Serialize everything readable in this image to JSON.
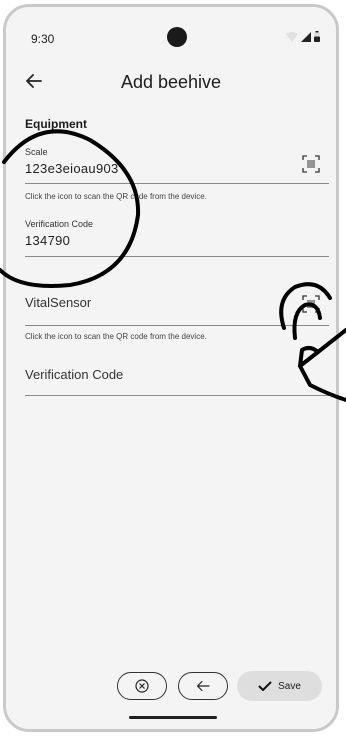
{
  "status": {
    "time": "9:30"
  },
  "appbar": {
    "title": "Add beehive"
  },
  "section": {
    "title": "Equipment"
  },
  "scale": {
    "label": "Scale",
    "value": "123e3eioau903",
    "hint": "Click the icon to scan the QR code from the device."
  },
  "scale_verification": {
    "label": "Verification Code",
    "value": "134790"
  },
  "vital": {
    "label": "VitalSensor",
    "hint": "Click the icon to scan the QR code from the device."
  },
  "vital_verification": {
    "label": "Verification Code"
  },
  "actions": {
    "save_label": "Save"
  },
  "colors": {
    "background": "#f4f4f4",
    "save_button": "#dedede",
    "annotation": "#000000"
  },
  "icons": {
    "back": "arrow-left-icon",
    "scan": "qr-scan-icon",
    "cancel": "cancel-circle-icon",
    "prev": "arrow-left-icon",
    "save": "check-icon",
    "tap": "tap-gesture-icon"
  }
}
